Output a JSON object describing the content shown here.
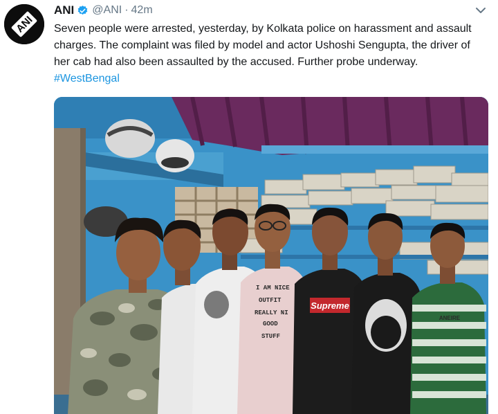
{
  "tweet": {
    "display_name": "ANI",
    "verified_icon": "verified-badge-icon",
    "handle": "@ANI",
    "separator": "·",
    "timestamp": "42m",
    "text_main": "Seven people were arrested, yesterday, by Kolkata police on harassment and assault charges. The complaint was filed by model and actor Ushoshi Sengupta, the driver of her cab had also been assaulted by the accused. Further probe underway.",
    "hashtag": "#WestBengal",
    "avatar_label": "ANI",
    "menu_icon": "chevron-down-icon"
  },
  "photo": {
    "shirt_texts": {
      "person4": [
        "I AM NICE",
        "OUTFIT",
        "REALLY NI",
        "GOOD",
        "STUFF"
      ],
      "person5": "Supreme",
      "person7": "ANEIRE"
    }
  },
  "colors": {
    "verified": "#1da1f2",
    "hashtag": "#1b95e0",
    "handle": "#657786",
    "text": "#14171a",
    "wall": "#3a92c8",
    "curtain": "#6a2a5e"
  }
}
